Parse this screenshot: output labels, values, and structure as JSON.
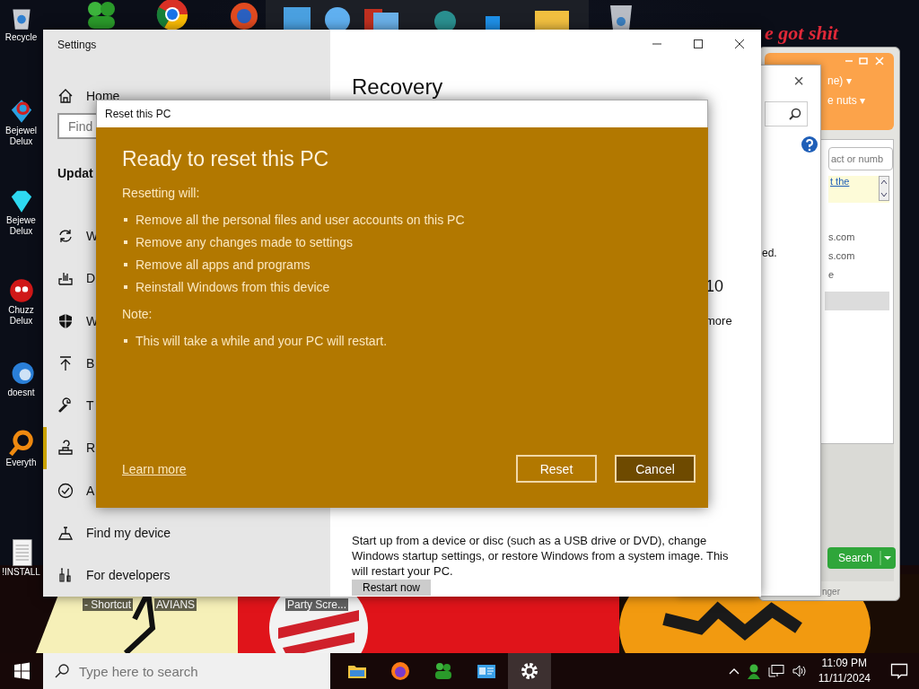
{
  "desktop": {
    "banner": "e got shit",
    "icons": [
      {
        "kind": "recycle",
        "label": "Recycle"
      },
      {
        "kind": "gem-two",
        "label": "Bejewel Delux"
      },
      {
        "kind": "gem",
        "label": "Bejewe Delux"
      },
      {
        "kind": "ball",
        "label": "Chuzz Delux"
      },
      {
        "kind": "bird",
        "label": "doesnt"
      },
      {
        "kind": "magnifier",
        "label": "Everyth"
      },
      {
        "kind": "document",
        "label": "!INSTALL"
      }
    ],
    "bottom_labels": [
      "- Shortcut",
      "AVIANS",
      "Party Scre..."
    ]
  },
  "right_window": {
    "menu": [
      "ne) ▾",
      "e nuts ▾"
    ],
    "search_placeholder": "act or numb",
    "link": "t the",
    "contacts": [
      {
        "text": "s.com",
        "selected": false
      },
      {
        "text": "s.com",
        "selected": false
      },
      {
        "text": "e",
        "selected": false
      },
      {
        "selected": true
      }
    ],
    "search_button": "Search",
    "footer": "nger"
  },
  "middle_window": {
    "close": "×",
    "status": "ed."
  },
  "settings": {
    "title": "Settings",
    "home": "Home",
    "find_placeholder": "Find",
    "section": "Updat",
    "items": [
      {
        "kind": "sync",
        "label": "W",
        "selected": false
      },
      {
        "kind": "delivery",
        "label": "D",
        "selected": false
      },
      {
        "kind": "shield",
        "label": "W",
        "selected": false
      },
      {
        "kind": "backup",
        "label": "B",
        "selected": false
      },
      {
        "kind": "wrench",
        "label": "T",
        "selected": false
      },
      {
        "kind": "recovery",
        "label": "R",
        "selected": true
      },
      {
        "kind": "check",
        "label": "A",
        "selected": false
      },
      {
        "kind": "locate",
        "label": "Find my device",
        "selected": false
      },
      {
        "kind": "dev",
        "label": "For developers",
        "selected": false
      }
    ],
    "heading": "Recovery",
    "fragment_version": "10",
    "fragment_more": "more",
    "advanced_text": "Start up from a device or disc (such as a USB drive or DVD), change Windows startup settings, or restore Windows from a system image. This will restart your PC.",
    "restart_button": "Restart now"
  },
  "dialog": {
    "title": "Reset this PC",
    "heading": "Ready to reset this PC",
    "intro": "Resetting will:",
    "bullets": [
      "Remove all the personal files and user accounts on this PC",
      "Remove any changes made to settings",
      "Remove all apps and programs",
      "Reinstall Windows from this device"
    ],
    "note_label": "Note:",
    "note_bullets": [
      "This will take a while and your PC will restart."
    ],
    "link": "Learn more",
    "buttons": [
      {
        "label": "Reset",
        "kind": "outline"
      },
      {
        "label": "Cancel",
        "kind": "filled"
      }
    ]
  },
  "taskbar": {
    "search_placeholder": "Type here to search",
    "apps": [
      {
        "kind": "folder",
        "selected": false
      },
      {
        "kind": "firefox",
        "selected": false
      },
      {
        "kind": "people",
        "selected": false
      },
      {
        "kind": "card",
        "selected": false
      },
      {
        "kind": "gear",
        "selected": true
      }
    ],
    "time": "11:09 PM",
    "date": "11/11/2024"
  }
}
